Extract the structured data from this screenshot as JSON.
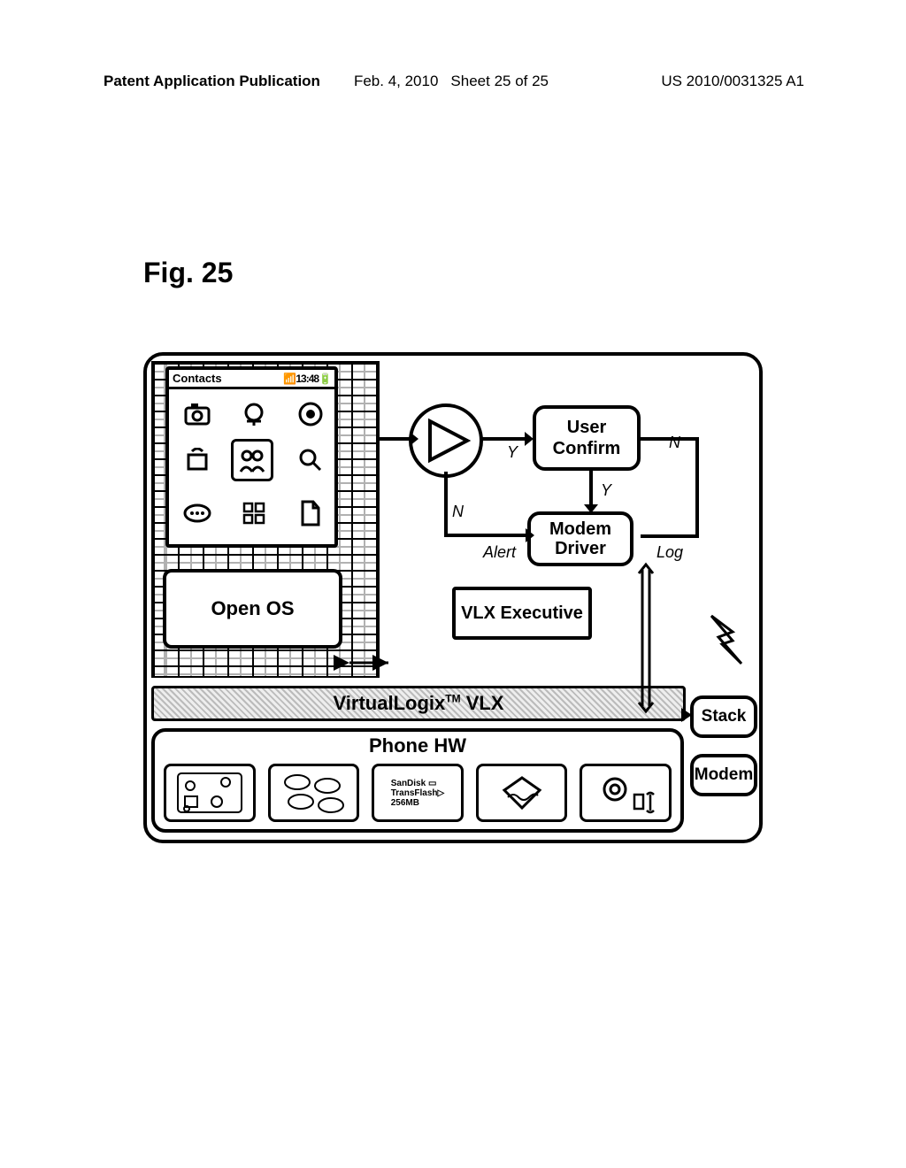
{
  "header": {
    "publication": "Patent Application Publication",
    "date": "Feb. 4, 2010",
    "sheet": "Sheet 25 of 25",
    "patent_no": "US 2010/0031325 A1"
  },
  "figure_label": "Fig. 25",
  "phone_screen": {
    "status_title": "Contacts",
    "status_right": "13:48"
  },
  "blocks": {
    "open_os": "Open OS",
    "vlx_layer_prefix": "VirtualLogix",
    "vlx_layer_suffix": " VLX",
    "vlx_layer_tm": "TM",
    "phone_hw": "Phone HW",
    "user_confirm": "User Confirm",
    "modem_driver": "Modem Driver",
    "vlx_executive": "VLX Executive",
    "stack": "Stack",
    "modem": "Modem"
  },
  "edge_labels": {
    "Y_from_amp": "Y",
    "N_to_log": "N",
    "Y_down": "Y",
    "N_from_amp": "N",
    "alert": "Alert",
    "log": "Log"
  },
  "hw": {
    "sandisk_line1": "SanDisk",
    "sandisk_line2": "TransFlash",
    "sandisk_line3": "256MB"
  }
}
